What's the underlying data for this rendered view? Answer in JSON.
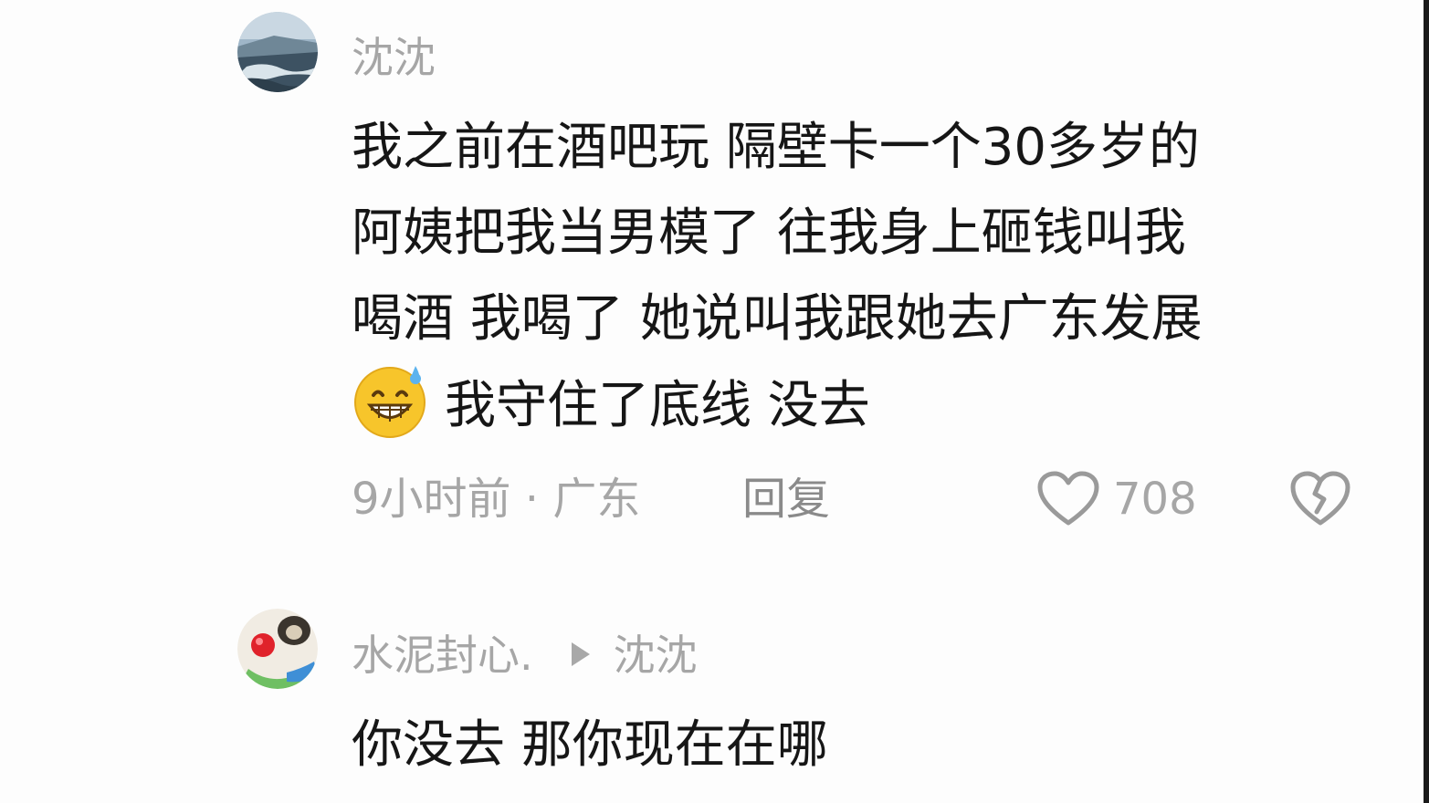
{
  "comments": [
    {
      "username": "沈沈",
      "avatar_icon": "landscape-avatar-icon",
      "lines": [
        "我之前在酒吧玩 隔壁卡一个30多岁的",
        "阿姨把我当男模了 往我身上砸钱叫我",
        "喝酒 我喝了 她说叫我跟她去广东发展",
        "我守住了底线 没去"
      ],
      "emoji": "grinning-sweat-emoji",
      "time_location": "9小时前 · 广东",
      "reply_label": "回复",
      "like_count": "708"
    },
    {
      "username": "水泥封心.",
      "reply_to": "沈沈",
      "avatar_icon": "cartoon-avatar-icon",
      "text": "你没去 那你现在在哪"
    }
  ],
  "colors": {
    "meta_gray": "#a6a6a6",
    "text_black": "#161616",
    "emoji_yellow": "#f7c52b"
  }
}
